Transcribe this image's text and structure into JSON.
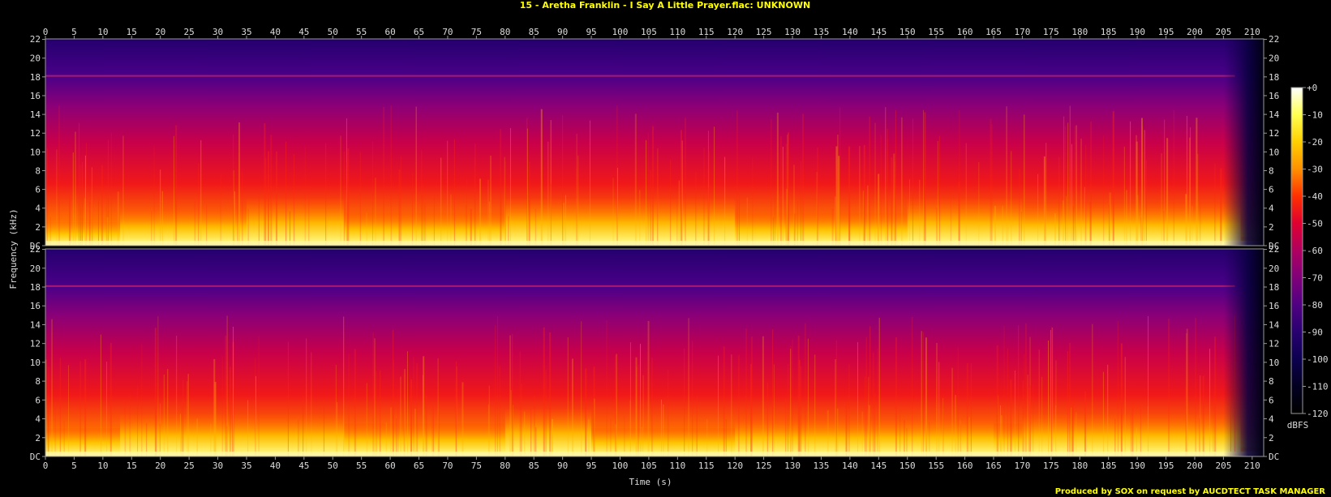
{
  "chart_data": {
    "type": "heatmap",
    "title": "15 - Aretha Franklin - I Say A Little Prayer.flac: UNKNOWN",
    "xlabel": "Time (s)",
    "ylabel": "Frequency (kHz)",
    "xlim": [
      0,
      212
    ],
    "ylim": [
      0,
      22.05
    ],
    "x_ticks": [
      0,
      5,
      10,
      15,
      20,
      25,
      30,
      35,
      40,
      45,
      50,
      55,
      60,
      65,
      70,
      75,
      80,
      85,
      90,
      95,
      100,
      105,
      110,
      115,
      120,
      125,
      130,
      135,
      140,
      145,
      150,
      155,
      160,
      165,
      170,
      175,
      180,
      185,
      190,
      195,
      200,
      205,
      210
    ],
    "y_ticks": [
      "DC",
      "2",
      "4",
      "6",
      "8",
      "10",
      "12",
      "14",
      "16",
      "18",
      "20",
      "22"
    ],
    "y_tick_values": [
      0,
      2,
      4,
      6,
      8,
      10,
      12,
      14,
      16,
      18,
      20,
      22
    ],
    "channels": [
      {
        "name": "",
        "note_line_khz": 18.1,
        "segments": [
          {
            "t0": 0,
            "t1": 13,
            "loud_khz": 2.5
          },
          {
            "t0": 13,
            "t1": 35,
            "loud_khz": 4
          },
          {
            "t0": 35,
            "t1": 52,
            "loud_khz": 5
          },
          {
            "t0": 52,
            "t1": 80,
            "loud_khz": 3.5
          },
          {
            "t0": 80,
            "t1": 120,
            "loud_khz": 5
          },
          {
            "t0": 120,
            "t1": 150,
            "loud_khz": 3.5
          },
          {
            "t0": 150,
            "t1": 170,
            "loud_khz": 5
          },
          {
            "t0": 170,
            "t1": 208,
            "loud_khz": 4.5
          },
          {
            "t0": 208,
            "t1": 212,
            "loud_khz": 1
          }
        ]
      },
      {
        "name": "",
        "note_line_khz": 18.1,
        "segments": [
          {
            "t0": 0,
            "t1": 13,
            "loud_khz": 3
          },
          {
            "t0": 13,
            "t1": 52,
            "loud_khz": 4.5
          },
          {
            "t0": 52,
            "t1": 80,
            "loud_khz": 3.5
          },
          {
            "t0": 80,
            "t1": 95,
            "loud_khz": 5
          },
          {
            "t0": 95,
            "t1": 120,
            "loud_khz": 3
          },
          {
            "t0": 120,
            "t1": 165,
            "loud_khz": 4
          },
          {
            "t0": 165,
            "t1": 170,
            "loud_khz": 3.5
          },
          {
            "t0": 170,
            "t1": 208,
            "loud_khz": 4.5
          },
          {
            "t0": 208,
            "t1": 212,
            "loud_khz": 1
          }
        ]
      }
    ],
    "colorbar": {
      "label": "dBFS",
      "ticks": [
        "+0",
        "-10",
        "-20",
        "-30",
        "-40",
        "-50",
        "-60",
        "-70",
        "-80",
        "-90",
        "-100",
        "-110",
        "-120"
      ],
      "stops": [
        "#ffffff",
        "#ffff50",
        "#ffd000",
        "#ff9000",
        "#ff3000",
        "#e00030",
        "#b00060",
        "#80007a",
        "#500082",
        "#280070",
        "#0c0050",
        "#020020",
        "#000000"
      ]
    },
    "colors": {
      "background": "#000000",
      "title": "#ffff00",
      "text": "#dddddd",
      "axes": "#9a9a9a",
      "credit": "#ffff00"
    }
  },
  "credit": "Produced by SOX on request by AUCDTECT TASK MANAGER"
}
